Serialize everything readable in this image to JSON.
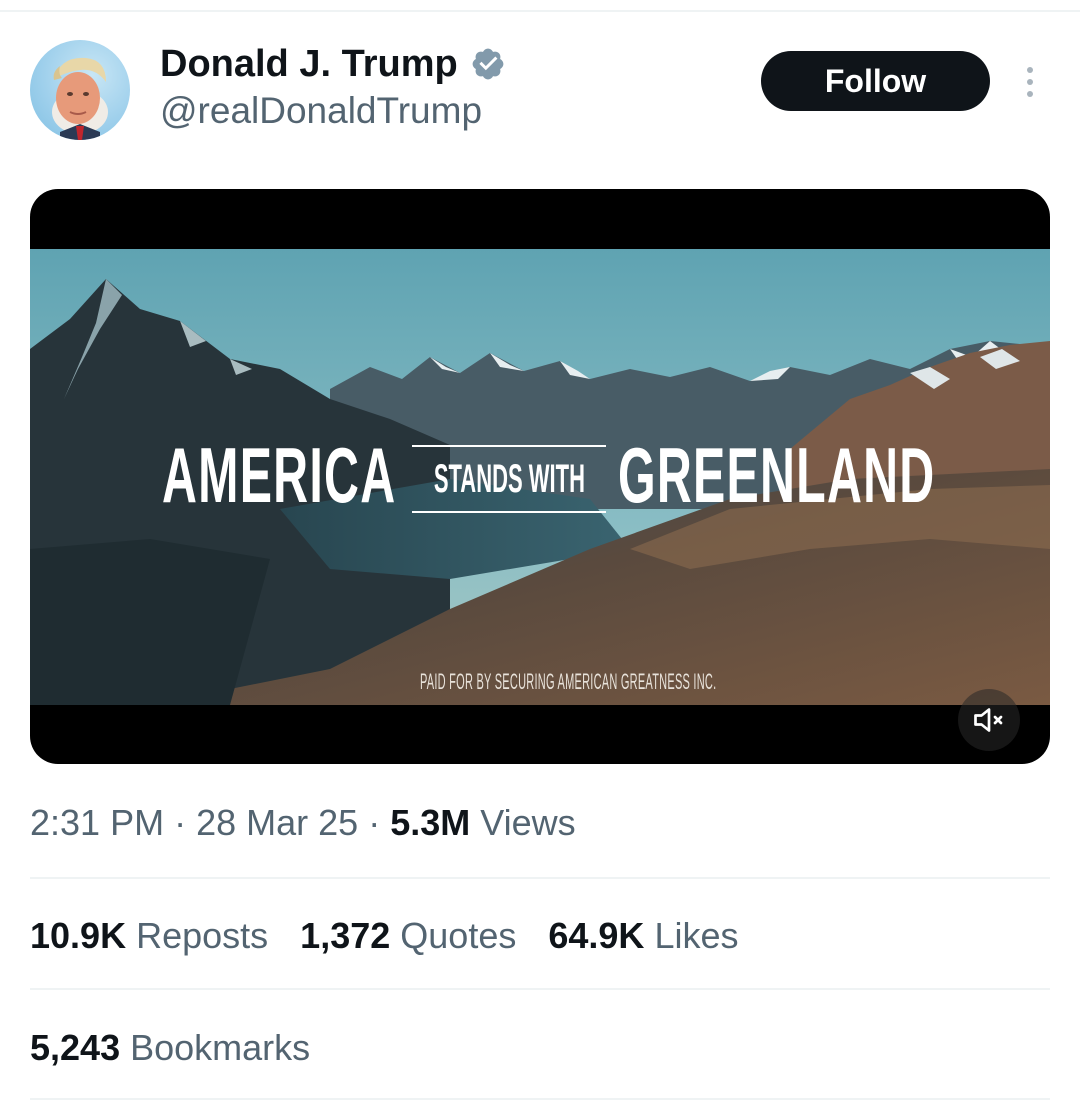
{
  "author": {
    "display_name": "Donald J. Trump",
    "handle": "@realDonaldTrump",
    "verified": true,
    "avatar_icon": "profile-photo"
  },
  "header": {
    "follow_label": "Follow",
    "more_icon": "more-vertical-icon"
  },
  "media": {
    "headline_left": "AMERICA",
    "headline_middle": "STANDS WITH",
    "headline_right": "GREENLAND",
    "disclaimer": "PAID FOR BY SECURING AMERICAN GREATNESS INC.",
    "mute_icon": "volume-muted-icon"
  },
  "meta": {
    "time": "2:31 PM",
    "separator": "·",
    "date": "28 Mar 25",
    "views_count": "5.3M",
    "views_label": "Views"
  },
  "stats": [
    {
      "value": "10.9K",
      "label": "Reposts"
    },
    {
      "value": "1,372",
      "label": "Quotes"
    },
    {
      "value": "64.9K",
      "label": "Likes"
    }
  ],
  "bookmarks": {
    "value": "5,243",
    "label": "Bookmarks"
  },
  "colors": {
    "text_primary": "#0f1419",
    "text_secondary": "#536471",
    "verified_badge": "#829aab",
    "follow_button_bg": "#0f1419",
    "divider": "#eff3f4"
  }
}
